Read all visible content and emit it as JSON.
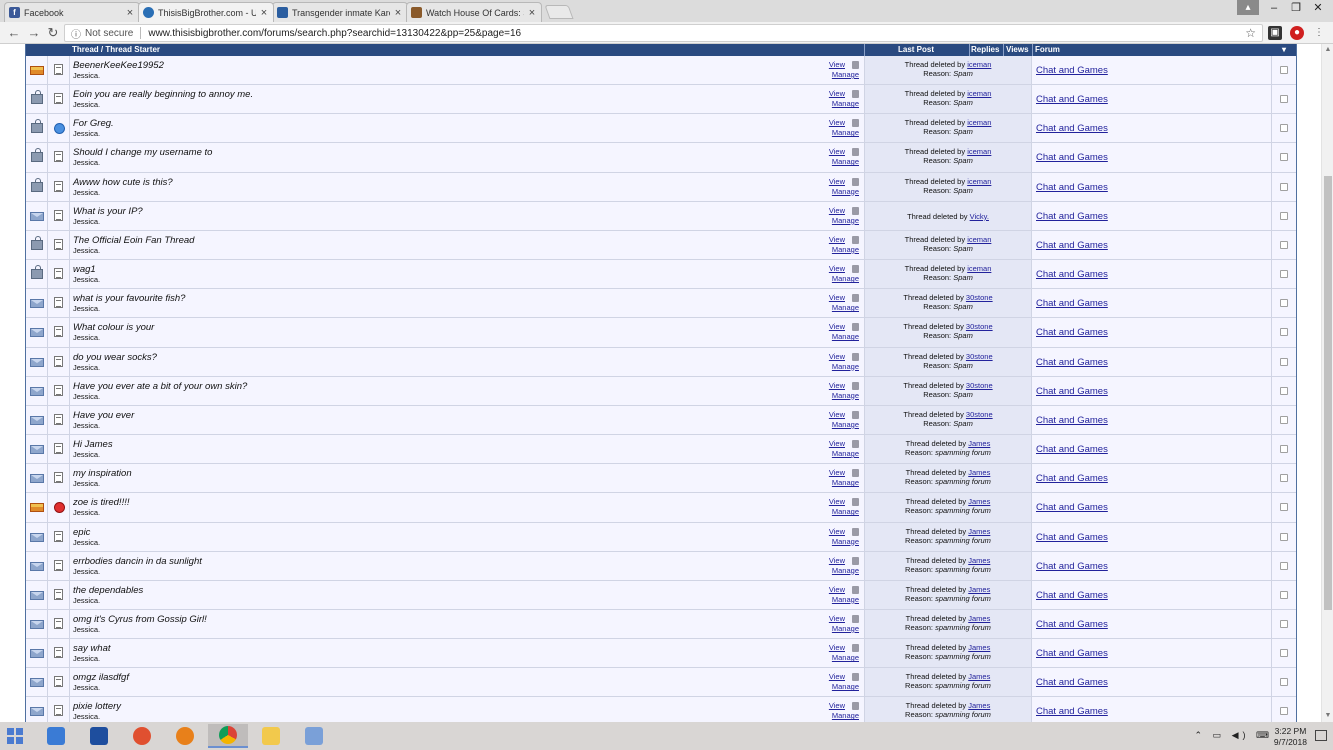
{
  "browser": {
    "tabs": [
      {
        "title": "Facebook",
        "favicon": "facebook-icon",
        "color": "#3b5998"
      },
      {
        "title": "ThisisBigBrother.com - Ul",
        "favicon": "tibb-icon",
        "color": "#2a6fb5"
      },
      {
        "title": "Transgender inmate Karer",
        "favicon": "news-icon",
        "color": "#2b5ea0"
      },
      {
        "title": "Watch House Of Cards: S",
        "favicon": "film-icon",
        "color": "#8a5a2a"
      }
    ],
    "security_label": "Not secure",
    "url": "www.thisisbigbrother.com/forums/search.php?searchid=13130422&pp=25&page=16"
  },
  "table": {
    "headers": {
      "thread": "Thread / Thread Starter",
      "last_post": "Last Post",
      "replies": "Replies",
      "views": "Views",
      "forum": "Forum"
    },
    "view_label": "View",
    "manage_label": "Manage",
    "deleted_prefix": "Thread deleted by",
    "reason_prefix": "Reason:",
    "rows": [
      {
        "title": "BeenerKeeKee19952",
        "starter": "Jessica.",
        "icon": "hot",
        "posticon": "post",
        "deleted_by": "iceman",
        "reason": "Spam",
        "forum": "Chat and Games"
      },
      {
        "title": "Eoin you are really beginning to annoy me.",
        "starter": "Jessica.",
        "icon": "lock",
        "posticon": "post",
        "deleted_by": "iceman",
        "reason": "Spam",
        "forum": "Chat and Games"
      },
      {
        "title": "For Greg.",
        "starter": "Jessica.",
        "icon": "lock",
        "posticon": "smile",
        "deleted_by": "iceman",
        "reason": "Spam",
        "forum": "Chat and Games"
      },
      {
        "title": "Should I change my username to",
        "starter": "Jessica.",
        "icon": "lock",
        "posticon": "post",
        "deleted_by": "iceman",
        "reason": "Spam",
        "forum": "Chat and Games"
      },
      {
        "title": "Awww how cute is this?",
        "starter": "Jessica.",
        "icon": "lock",
        "posticon": "post",
        "deleted_by": "iceman",
        "reason": "Spam",
        "forum": "Chat and Games"
      },
      {
        "title": "What is your IP?",
        "starter": "Jessica.",
        "icon": "env",
        "posticon": "post",
        "deleted_by": "Vicky.",
        "reason": "",
        "forum": "Chat and Games"
      },
      {
        "title": "The Official Eoin Fan Thread",
        "starter": "Jessica.",
        "icon": "lock",
        "posticon": "post",
        "deleted_by": "iceman",
        "reason": "Spam",
        "forum": "Chat and Games"
      },
      {
        "title": "wag1",
        "starter": "Jessica.",
        "icon": "lock",
        "posticon": "post",
        "deleted_by": "iceman",
        "reason": "Spam",
        "forum": "Chat and Games"
      },
      {
        "title": "what is your favourite fish?",
        "starter": "Jessica.",
        "icon": "env",
        "posticon": "post",
        "deleted_by": "30stone",
        "reason": "Spam",
        "forum": "Chat and Games"
      },
      {
        "title": "What colour is your",
        "starter": "Jessica.",
        "icon": "env",
        "posticon": "post",
        "deleted_by": "30stone",
        "reason": "Spam",
        "forum": "Chat and Games"
      },
      {
        "title": "do you wear socks?",
        "starter": "Jessica.",
        "icon": "env",
        "posticon": "post",
        "deleted_by": "30stone",
        "reason": "Spam",
        "forum": "Chat and Games"
      },
      {
        "title": "Have you ever ate a bit of your own skin?",
        "starter": "Jessica.",
        "icon": "env",
        "posticon": "post",
        "deleted_by": "30stone",
        "reason": "Spam",
        "forum": "Chat and Games"
      },
      {
        "title": "Have you ever",
        "starter": "Jessica.",
        "icon": "env",
        "posticon": "post",
        "deleted_by": "30stone",
        "reason": "Spam",
        "forum": "Chat and Games"
      },
      {
        "title": "Hi James",
        "starter": "Jessica.",
        "icon": "env",
        "posticon": "post",
        "deleted_by": "James",
        "reason": "spamming forum",
        "forum": "Chat and Games"
      },
      {
        "title": "my inspiration",
        "starter": "Jessica.",
        "icon": "env",
        "posticon": "post",
        "deleted_by": "James",
        "reason": "spamming forum",
        "forum": "Chat and Games"
      },
      {
        "title": "zoe is tired!!!!",
        "starter": "Jessica.",
        "icon": "hot",
        "posticon": "angry",
        "deleted_by": "James",
        "reason": "spamming forum",
        "forum": "Chat and Games"
      },
      {
        "title": "epic",
        "starter": "Jessica.",
        "icon": "env",
        "posticon": "post",
        "deleted_by": "James",
        "reason": "spamming forum",
        "forum": "Chat and Games"
      },
      {
        "title": "errbodies dancin in da sunlight",
        "starter": "Jessica.",
        "icon": "env",
        "posticon": "post",
        "deleted_by": "James",
        "reason": "spamming forum",
        "forum": "Chat and Games"
      },
      {
        "title": "the dependables",
        "starter": "Jessica.",
        "icon": "env",
        "posticon": "post",
        "deleted_by": "James",
        "reason": "spamming forum",
        "forum": "Chat and Games"
      },
      {
        "title": "omg it's Cyrus from Gossip Girl!",
        "starter": "Jessica.",
        "icon": "env",
        "posticon": "post",
        "deleted_by": "James",
        "reason": "spamming forum",
        "forum": "Chat and Games"
      },
      {
        "title": "say what",
        "starter": "Jessica.",
        "icon": "env",
        "posticon": "post",
        "deleted_by": "James",
        "reason": "spamming forum",
        "forum": "Chat and Games"
      },
      {
        "title": "omgz ilasdfgf",
        "starter": "Jessica.",
        "icon": "env",
        "posticon": "post",
        "deleted_by": "James",
        "reason": "spamming forum",
        "forum": "Chat and Games"
      },
      {
        "title": "pixie lottery",
        "starter": "Jessica.",
        "icon": "env",
        "posticon": "post",
        "deleted_by": "James",
        "reason": "spamming forum",
        "forum": "Chat and Games"
      }
    ]
  },
  "taskbar": {
    "apps": [
      "ie-icon",
      "outlook-icon",
      "paint-icon",
      "firefox-icon",
      "chrome-icon",
      "explorer-icon",
      "paint3d-icon"
    ],
    "time": "3:22 PM",
    "date": "9/7/2018"
  }
}
